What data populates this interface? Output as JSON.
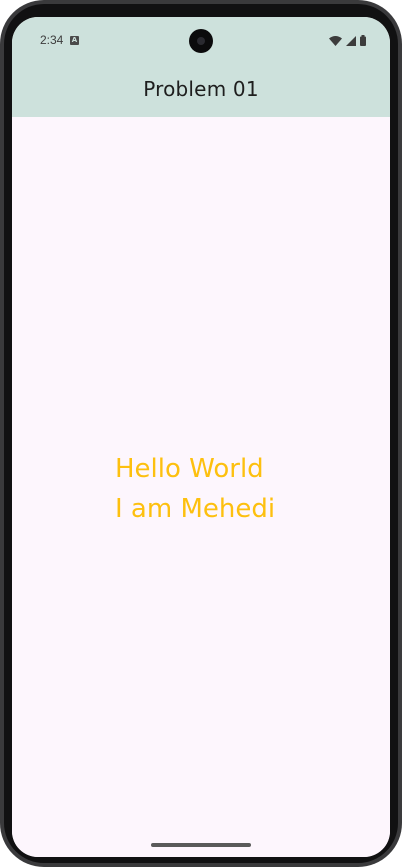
{
  "status_bar": {
    "time": "2:34",
    "notification_icon": "a-icon",
    "camera_icon": "front-camera",
    "icons": [
      "wifi-icon",
      "cellular-signal-icon",
      "battery-icon"
    ],
    "background": "#cde1dc"
  },
  "app_bar": {
    "title": "Problem 01",
    "background": "#cde1dc"
  },
  "body": {
    "line1": "Hello World",
    "line2": "I am Mehedi",
    "text_color": "#fdc00f",
    "background": "#fdf6fd"
  }
}
